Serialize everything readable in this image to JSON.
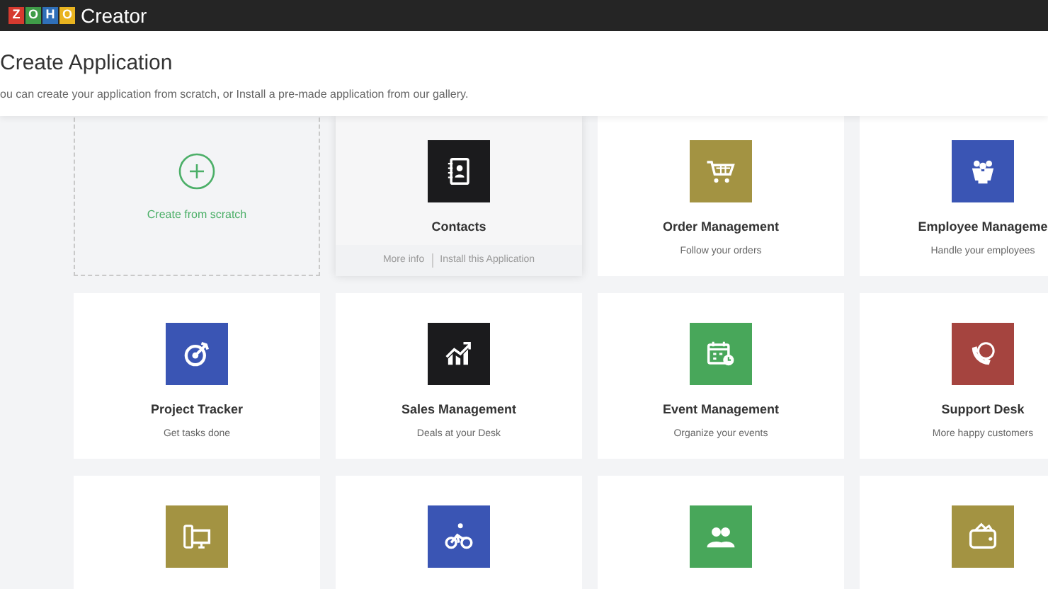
{
  "topbar": {
    "logo_letters": [
      "Z",
      "O",
      "H",
      "O"
    ],
    "product": "Creator"
  },
  "header": {
    "title": "Create Application",
    "subtitle": "ou can create your application from scratch, or Install a pre-made application from our gallery."
  },
  "create_card": {
    "label": "Create from scratch"
  },
  "apps": [
    {
      "name": "Contacts",
      "color": "#1b1b1d",
      "selected": true,
      "actions": [
        "More info",
        "Install this Application"
      ]
    },
    {
      "name": "Order Management",
      "description": "Follow your orders",
      "color": "#a39342",
      "selected": false
    },
    {
      "name": "Employee Manageme",
      "description": "Handle your employees",
      "color": "#3a55b4",
      "selected": false
    },
    {
      "name": "Project Tracker",
      "description": "Get tasks done",
      "color": "#3a55b4",
      "selected": false
    },
    {
      "name": "Sales Management",
      "description": "Deals at your Desk",
      "color": "#1b1b1d",
      "selected": false
    },
    {
      "name": "Event Management",
      "description": "Organize your events",
      "color": "#48a75a",
      "selected": false
    },
    {
      "name": "Support Desk",
      "description": "More happy customers",
      "color": "#a5443f",
      "selected": false
    },
    {
      "color": "#a39342",
      "selected": false
    },
    {
      "color": "#3a55b4",
      "selected": false
    },
    {
      "color": "#48a75a",
      "selected": false
    },
    {
      "color": "#a39342",
      "selected": false
    }
  ]
}
